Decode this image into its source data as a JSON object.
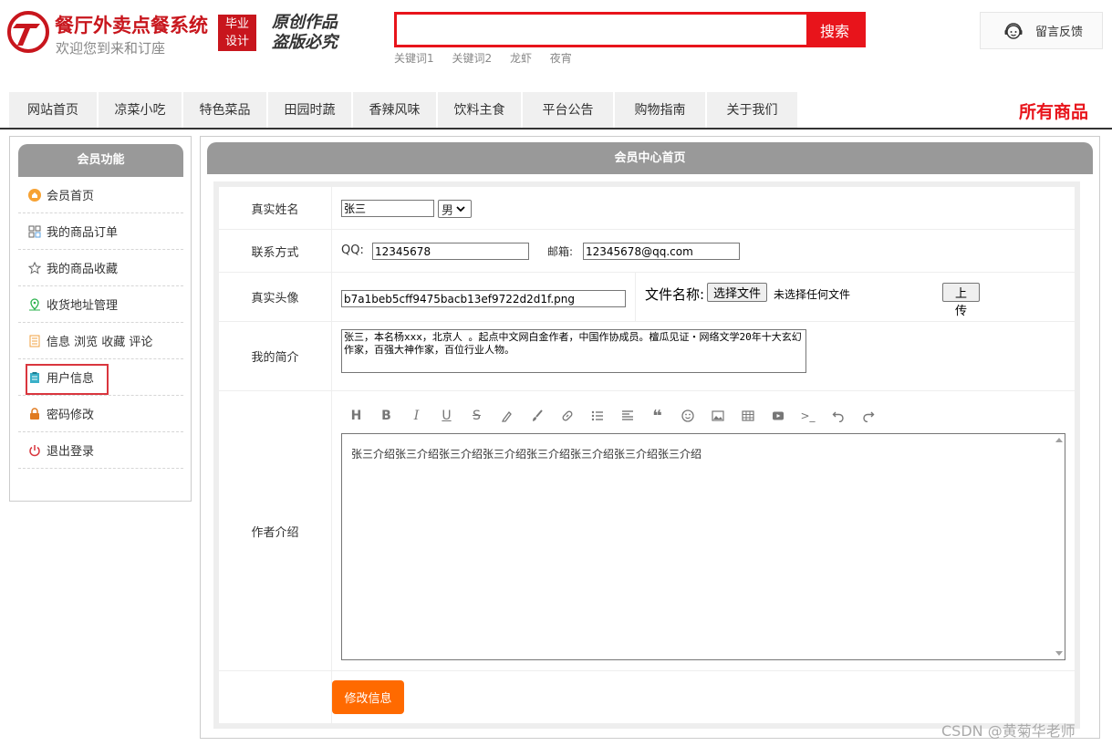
{
  "header": {
    "title": "餐厅外卖点餐系统",
    "subtitle": "欢迎您到来和订座",
    "badge_line1": "毕业",
    "badge_line2": "设计",
    "slogan_line1": "原创作品",
    "slogan_line2": "盗版必究",
    "search_value": "",
    "search_button": "搜索",
    "keywords": [
      "关键词1",
      "关键词2",
      "龙虾",
      "夜宵"
    ],
    "feedback_label": "留言反馈"
  },
  "nav": {
    "items": [
      "网站首页",
      "凉菜小吃",
      "特色菜品",
      "田园时蔬",
      "香辣风味",
      "饮料主食",
      "平台公告",
      "购物指南",
      "关于我们"
    ],
    "all_goods": "所有商品"
  },
  "sidebar": {
    "title": "会员功能",
    "items": [
      {
        "label": "会员首页",
        "icon": "member-home-icon"
      },
      {
        "label": "我的商品订单",
        "icon": "order-icon"
      },
      {
        "label": "我的商品收藏",
        "icon": "star-icon"
      },
      {
        "label": "收货地址管理",
        "icon": "location-icon"
      },
      {
        "label": "信息 浏览 收藏 评论",
        "icon": "list-icon"
      },
      {
        "label": "用户信息",
        "icon": "clipboard-icon"
      },
      {
        "label": "密码修改",
        "icon": "lock-icon"
      },
      {
        "label": "退出登录",
        "icon": "power-icon"
      }
    ],
    "active_index": 5
  },
  "main": {
    "title": "会员中心首页",
    "form": {
      "name_label": "真实姓名",
      "name_value": "张三",
      "gender_value": "男",
      "contact_label": "联系方式",
      "qq_label": "QQ:",
      "qq_value": "12345678",
      "email_label": "邮箱:",
      "email_value": "12345678@qq.com",
      "avatar_label": "真实头像",
      "avatar_value": "b7a1beb5cff9475bacb13ef9722d2d1f.png",
      "file_name_label": "文件名称:",
      "choose_file_button": "选择文件",
      "no_file_text": "未选择任何文件",
      "upload_button": "上 传",
      "bio_label": "我的简介",
      "bio_value": "张三，本名杨xxx，北京人 。起点中文网白金作者，中国作协成员。檀瓜见证・网络文学20年十大玄幻作家，百强大神作家，百位行业人物。",
      "author_label": "作者介绍",
      "author_value": "张三介绍张三介绍张三介绍张三介绍张三介绍张三介绍张三介绍张三介绍",
      "submit_button": "修改信息"
    }
  },
  "watermark": "CSDN @黄菊华老师",
  "colors": {
    "brand_red": "#c8161d",
    "search_red": "#e8141b",
    "submit_orange": "#ff6a00",
    "panel_gray": "#999999"
  }
}
